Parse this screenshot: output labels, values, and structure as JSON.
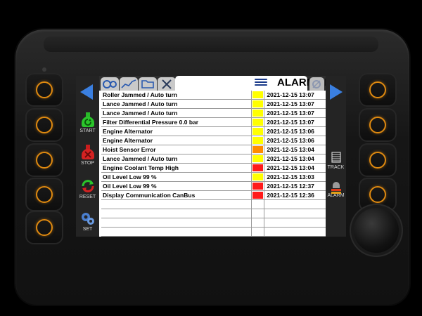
{
  "header": {
    "title": "ALARM LIST"
  },
  "colors": {
    "yellow": "#ffff00",
    "orange": "#ff8c00",
    "red": "#ff1a1a",
    "accent": "#3a7fe0"
  },
  "side_left": {
    "start_label": "START",
    "stop_label": "STOP",
    "reset_label": "RESET",
    "set_label": "SET"
  },
  "side_right": {
    "track_label": "TRACK",
    "alarm_label": "ALARM"
  },
  "tabs": [
    {
      "icon": "gears-icon"
    },
    {
      "icon": "trend-chart-icon"
    },
    {
      "icon": "folder-icon"
    },
    {
      "icon": "tools-icon"
    },
    {
      "icon": "list-icon"
    },
    {
      "icon": "disabled-gear-icon"
    },
    {
      "icon": "disabled-gear-icon"
    }
  ],
  "alarms": [
    {
      "message": "Roller Jammed / Auto turn",
      "severity": "yellow",
      "timestamp": "2021-12-15 13:07"
    },
    {
      "message": "Lance Jammed / Auto turn",
      "severity": "yellow",
      "timestamp": "2021-12-15 13:07"
    },
    {
      "message": "Lance Jammed / Auto turn",
      "severity": "yellow",
      "timestamp": "2021-12-15 13:07"
    },
    {
      "message": "Filter Differential Pressure 0.0 bar",
      "severity": "yellow",
      "timestamp": "2021-12-15 13:07"
    },
    {
      "message": "Engine Alternator",
      "severity": "yellow",
      "timestamp": "2021-12-15 13:06"
    },
    {
      "message": "Engine Alternator",
      "severity": "yellow",
      "timestamp": "2021-12-15 13:06"
    },
    {
      "message": "Hoist Sensor Error",
      "severity": "orange",
      "timestamp": "2021-12-15 13:04"
    },
    {
      "message": "Lance Jammed / Auto turn",
      "severity": "yellow",
      "timestamp": "2021-12-15 13:04"
    },
    {
      "message": "Engine Coolant Temp High",
      "severity": "red",
      "timestamp": "2021-12-15 13:04"
    },
    {
      "message": "Oil Level Low 99 %",
      "severity": "yellow",
      "timestamp": "2021-12-15 13:03"
    },
    {
      "message": "Oil Level Low 99 %",
      "severity": "red",
      "timestamp": "2021-12-15 12:37"
    },
    {
      "message": "Display Communication CanBus",
      "severity": "red",
      "timestamp": "2021-12-15 12:36"
    }
  ],
  "empty_rows": 4
}
